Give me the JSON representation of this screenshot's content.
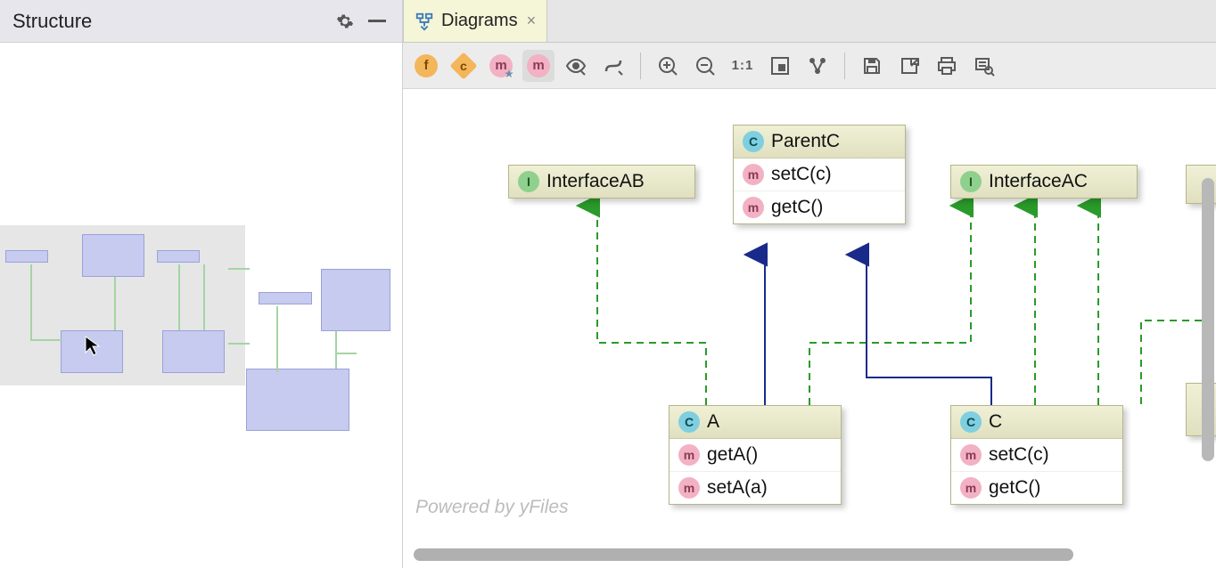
{
  "left": {
    "title": "Structure"
  },
  "tab": {
    "label": "Diagrams",
    "close": "×"
  },
  "toolbar": {
    "f": "f",
    "c": "c",
    "m1": "m",
    "m2": "m",
    "oneToOne": "1:1"
  },
  "nodes": {
    "interfaceAB": {
      "name": "InterfaceAB"
    },
    "interfaceAC": {
      "name": "InterfaceAC"
    },
    "parentC": {
      "name": "ParentC",
      "m1": "setC(c)",
      "m2": "getC()"
    },
    "a": {
      "name": "A",
      "m1": "getA()",
      "m2": "setA(a)"
    },
    "c": {
      "name": "C",
      "m1": "setC(c)",
      "m2": "getC()"
    }
  },
  "credit": "Powered by yFiles"
}
